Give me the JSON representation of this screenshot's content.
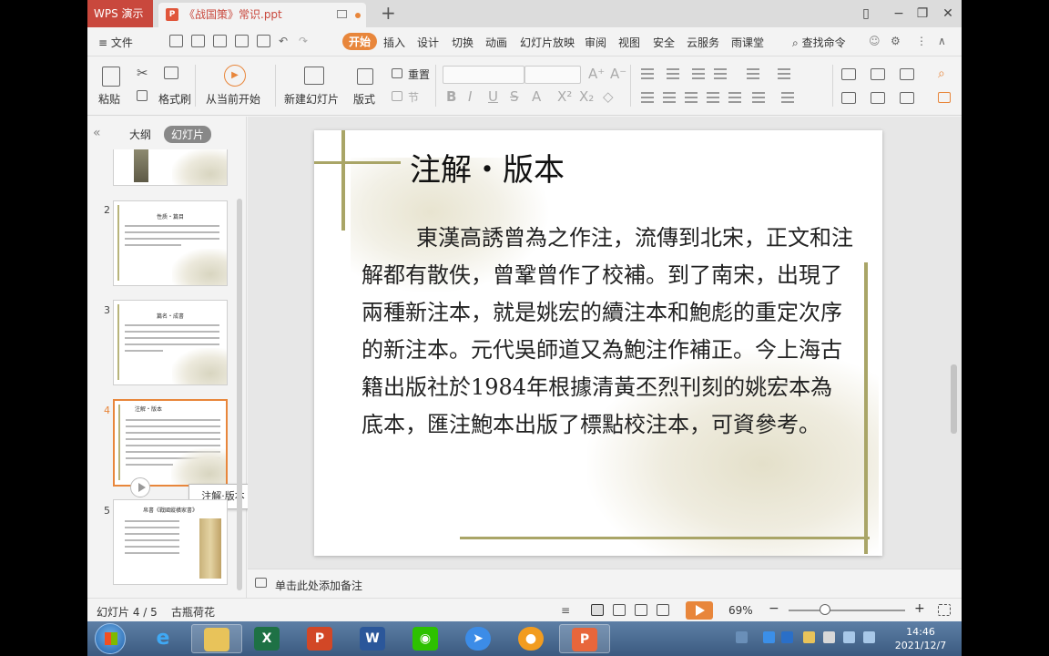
{
  "titlebar": {
    "app_name": "WPS 演示",
    "doc_tab": "《战国策》常识.ppt",
    "new_tab": "+"
  },
  "menubar": {
    "file": "≡ 文件",
    "items": [
      "开始",
      "插入",
      "设计",
      "切换",
      "动画",
      "幻灯片放映",
      "审阅",
      "视图",
      "安全",
      "云服务",
      "雨课堂"
    ],
    "active": "开始",
    "search": "查找命令"
  },
  "ribbon": {
    "paste": "粘贴",
    "format_painter": "格式刷",
    "from_current": "从当前开始",
    "new_slide": "新建幻灯片",
    "layout": "版式",
    "reset": "重置",
    "section": "节"
  },
  "left_panel": {
    "tab_outline": "大纲",
    "tab_slides": "幻灯片",
    "thumbnails": [
      {
        "num": "2",
        "title": "性质・篇目"
      },
      {
        "num": "3",
        "title": "篇名・成書"
      },
      {
        "num": "4",
        "title": "注解・版本"
      },
      {
        "num": "5",
        "title": "帛書《戰國縱橫家書》"
      }
    ],
    "tooltip": "注解·版本"
  },
  "slide": {
    "title": "注解・版本",
    "body": "東漢高誘曾為之作注，流傳到北宋，正文和注解都有散佚，曾鞏曾作了校補。到了南宋，出現了兩種新注本，就是姚宏的續注本和鮑彪的重定次序的新注本。元代吳師道又為鮑注作補正。今上海古籍出版社於1984年根據清黃丕烈刊刻的姚宏本為底本，匯注鮑本出版了標點校注本，可資參考。"
  },
  "notes": {
    "placeholder": "单击此处添加备注"
  },
  "statusbar": {
    "slide_info": "幻灯片 4 / 5",
    "theme": "古瓶荷花",
    "zoom": "69%",
    "zoom_minus": "−",
    "zoom_plus": "+"
  },
  "taskbar": {
    "time": "14:46",
    "date": "2021/12/7"
  },
  "colors": {
    "accent": "#e8863b",
    "wps_red": "#c9483d",
    "vine": "#a9a567"
  }
}
